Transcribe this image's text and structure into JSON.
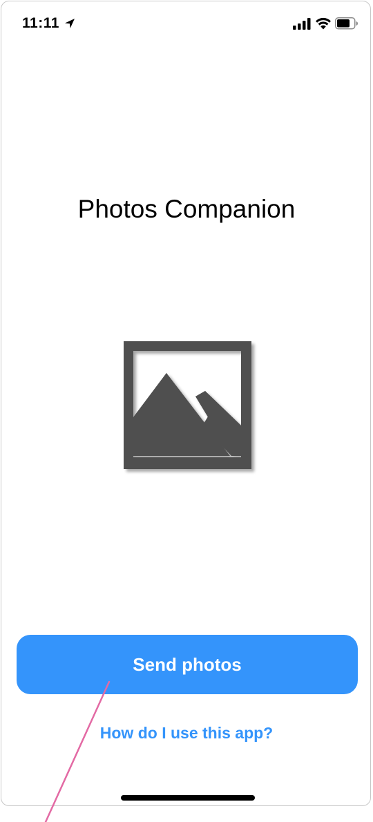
{
  "status_bar": {
    "time": "11:11",
    "icons": [
      "location-arrow-icon",
      "cellular-signal-icon",
      "wifi-icon",
      "battery-icon"
    ]
  },
  "main": {
    "title": "Photos Companion",
    "illustration_icon": "photo-landscape-icon",
    "send_button_label": "Send photos",
    "help_link_label": "How do I use this app?"
  },
  "colors": {
    "accent": "#3494fb",
    "illustration": "#505050",
    "annotation": "#e36aa4"
  }
}
